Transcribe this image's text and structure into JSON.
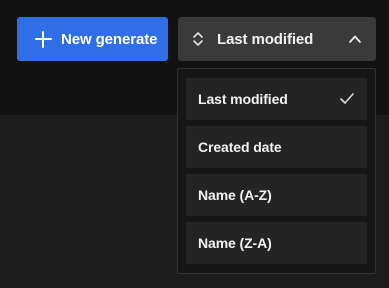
{
  "toolbar": {
    "new_button_label": "New generate",
    "sort_button_label": "Last modified",
    "sort_icon": "sort-arrows-icon",
    "chevron_icon": "chevron-up-icon"
  },
  "sort_menu": {
    "items": [
      {
        "label": "Last modified",
        "selected": true
      },
      {
        "label": "Created date",
        "selected": false
      },
      {
        "label": "Name (A-Z)",
        "selected": false
      },
      {
        "label": "Name (Z-A)",
        "selected": false
      }
    ],
    "selected_icon": "check-icon"
  },
  "colors": {
    "primary_button": "#2f6ee6",
    "sort_button": "#3a3a3a",
    "menu_item": "#242424",
    "background_top": "#121212",
    "background_bottom": "#1c1c1c"
  }
}
